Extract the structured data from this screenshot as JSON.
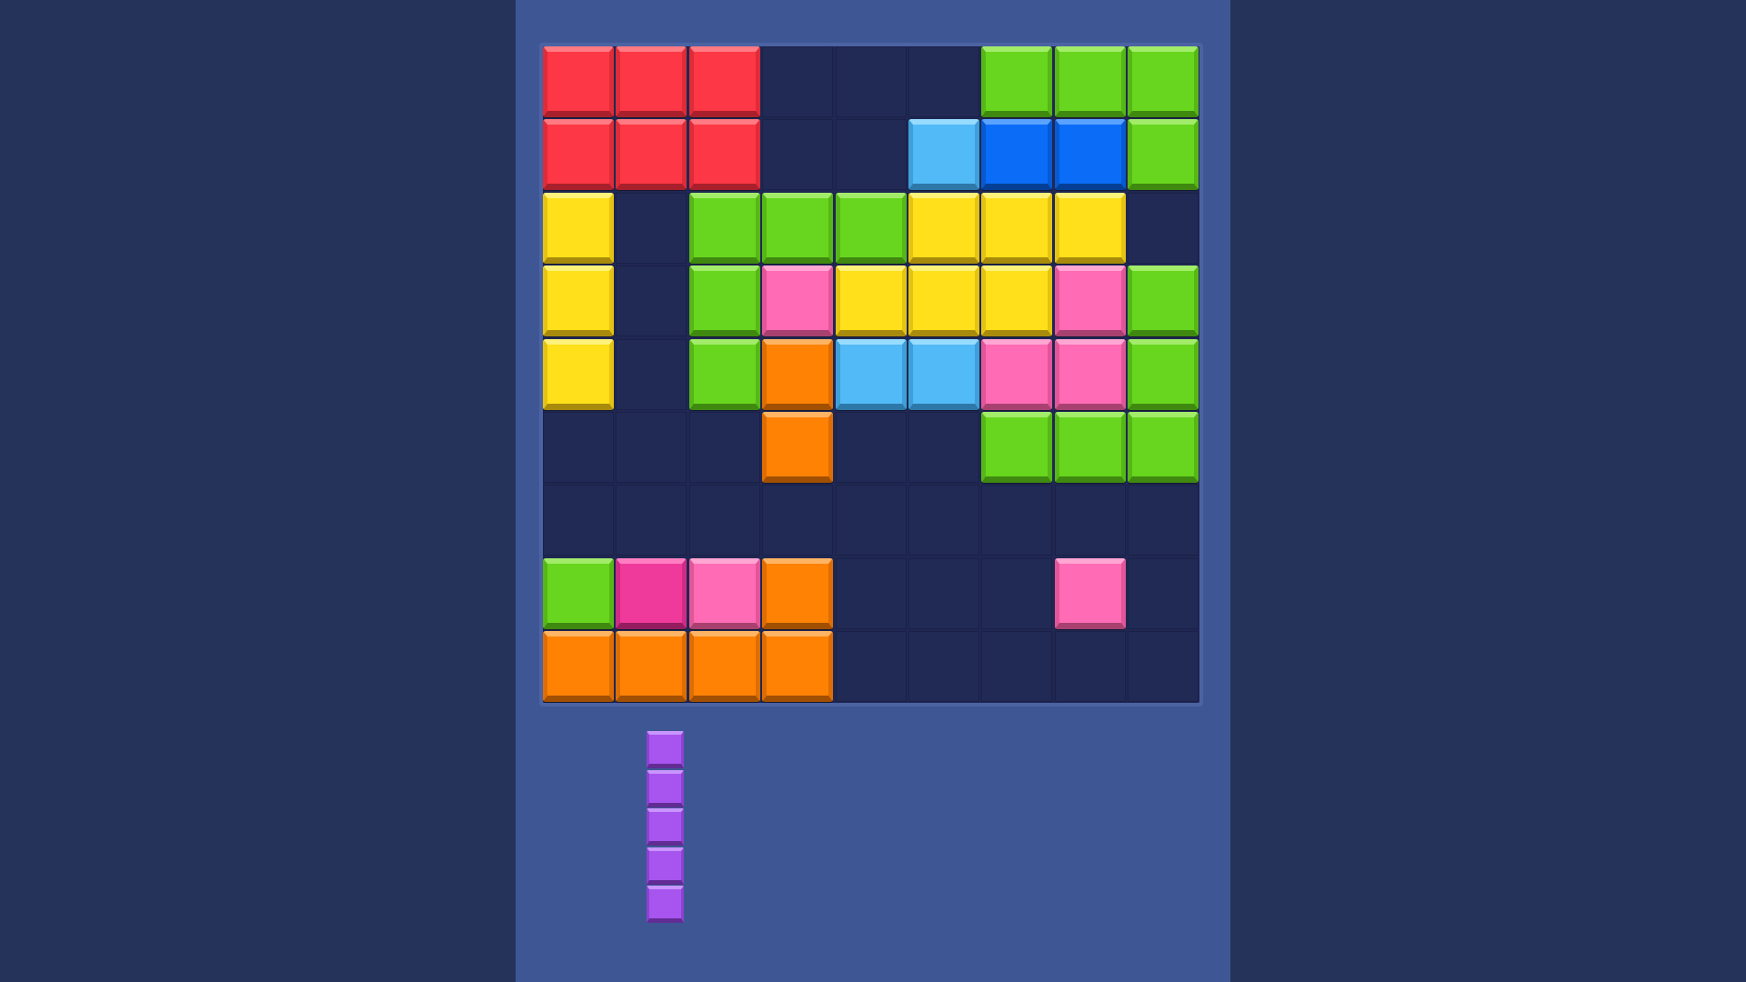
{
  "colors": {
    "R": {
      "face": "#fd3745",
      "top": "#ff7a82",
      "side": "#de2c39",
      "bottom": "#a8202b"
    },
    "G": {
      "face": "#68d61e",
      "top": "#a2ec6a",
      "side": "#56b717",
      "bottom": "#3f8910"
    },
    "Y": {
      "face": "#ffe01a",
      "top": "#fff27a",
      "side": "#e5c312",
      "bottom": "#a88b0c"
    },
    "B": {
      "face": "#52baf7",
      "top": "#97dcff",
      "side": "#3f9fd8",
      "bottom": "#2d78a8"
    },
    "D": {
      "face": "#0b6cf7",
      "top": "#5aa2ff",
      "side": "#075ad1",
      "bottom": "#043f95"
    },
    "P": {
      "face": "#ff6bb4",
      "top": "#ffa6d3",
      "side": "#e25699",
      "bottom": "#a8416f"
    },
    "M": {
      "face": "#ef3a9c",
      "top": "#ff7ec2",
      "side": "#cf2c85",
      "bottom": "#931d5e"
    },
    "O": {
      "face": "#ff8205",
      "top": "#ffb463",
      "side": "#de6e03",
      "bottom": "#a14f02"
    },
    "V": {
      "face": "#a855f0",
      "top": "#c995ff",
      "side": "#8c42d1",
      "bottom": "#612c94"
    }
  },
  "board": {
    "rows": 9,
    "cols": 9,
    "grid": [
      [
        "R",
        "R",
        "R",
        "",
        "",
        "",
        "G",
        "G",
        "G"
      ],
      [
        "R",
        "R",
        "R",
        "",
        "",
        "B",
        "D",
        "D",
        "G"
      ],
      [
        "Y",
        "",
        "G",
        "G",
        "G",
        "Y",
        "Y",
        "Y",
        ""
      ],
      [
        "Y",
        "",
        "G",
        "P",
        "Y",
        "Y",
        "Y",
        "P",
        "G"
      ],
      [
        "Y",
        "",
        "G",
        "O",
        "B",
        "B",
        "P",
        "P",
        "G"
      ],
      [
        "",
        "",
        "",
        "O",
        "",
        "",
        "G",
        "G",
        "G"
      ],
      [
        "",
        "",
        "",
        "",
        "",
        "",
        "",
        "",
        ""
      ],
      [
        "G",
        "M",
        "P",
        "O",
        "",
        "",
        "",
        "P",
        ""
      ],
      [
        "O",
        "O",
        "O",
        "O",
        "",
        "",
        "",
        "",
        ""
      ]
    ]
  },
  "tray": {
    "pieces": [
      {
        "name": "vertical-i5-piece",
        "color": "V",
        "cells": [
          [
            0,
            0
          ],
          [
            1,
            0
          ],
          [
            2,
            0
          ],
          [
            3,
            0
          ],
          [
            4,
            0
          ]
        ]
      }
    ]
  }
}
